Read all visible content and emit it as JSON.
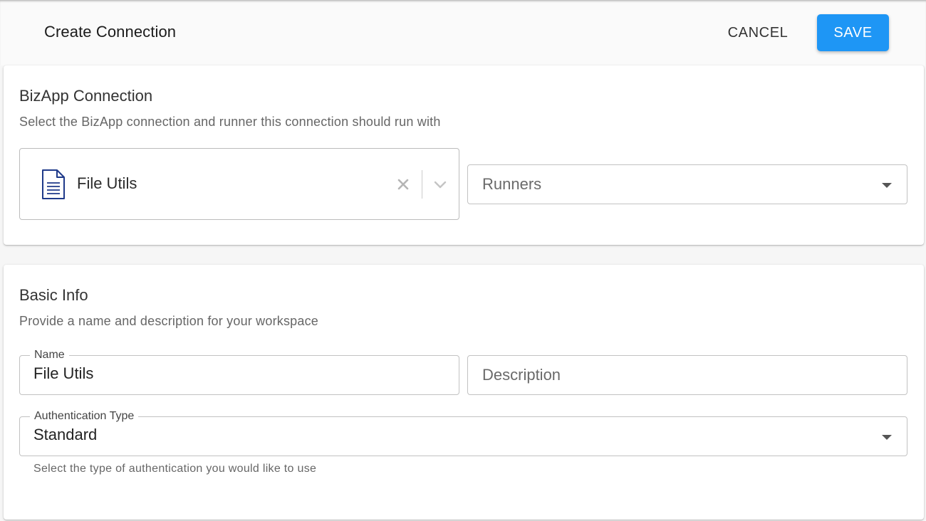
{
  "toolbar": {
    "title": "Create Connection",
    "cancel_label": "CANCEL",
    "save_label": "SAVE",
    "save_color": "#1e96f5"
  },
  "bizapp_section": {
    "title": "BizApp Connection",
    "subtitle": "Select the BizApp connection and runner this connection should run with",
    "connection_select": {
      "icon": "document-icon",
      "value": "File Utils"
    },
    "runners_select": {
      "placeholder": "Runners"
    }
  },
  "basic_info_section": {
    "title": "Basic Info",
    "subtitle": "Provide a name and description for your workspace",
    "name_field": {
      "label": "Name",
      "value": "File Utils"
    },
    "description_field": {
      "placeholder": "Description"
    },
    "auth_type_field": {
      "label": "Authentication Type",
      "value": "Standard",
      "helper": "Select the type of authentication you would like to use"
    }
  }
}
